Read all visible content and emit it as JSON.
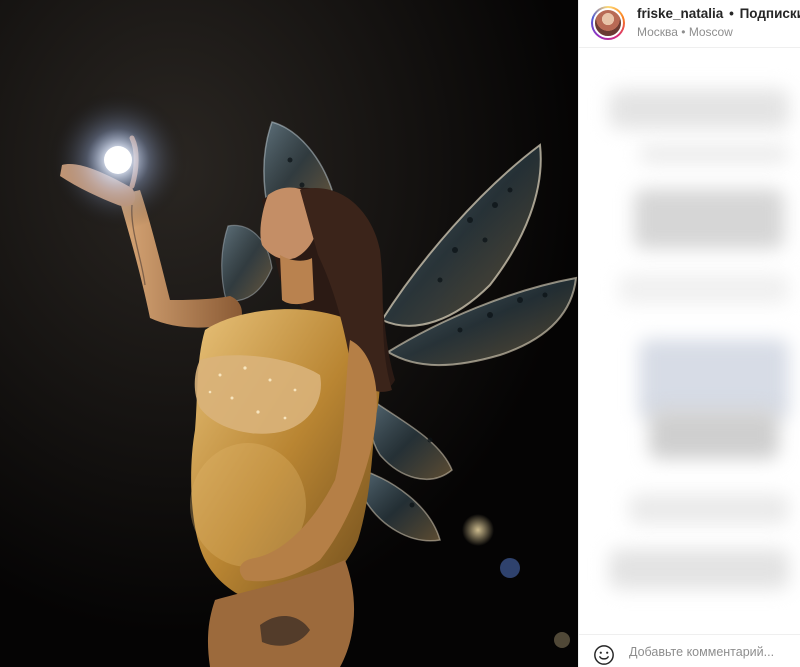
{
  "post": {
    "username": "friske_natalia",
    "separator": "•",
    "follow_label": "Подписки",
    "location": "Москва • Moscow"
  },
  "comment_box": {
    "placeholder": "Добавьте комментарий..."
  },
  "icons": {
    "emoji": "smiley-face-icon",
    "avatar": "profile-avatar"
  },
  "colors": {
    "photo_background": "#050404",
    "accent_gold": "#c9973f",
    "text_primary": "#262626",
    "text_secondary": "#8e8e8e"
  }
}
